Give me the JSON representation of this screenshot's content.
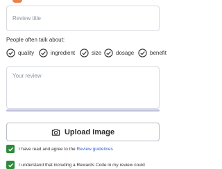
{
  "form": {
    "title_placeholder": "Review title",
    "talk_about_prompt": "People often talk about:",
    "topics": [
      "quality",
      "ingredient",
      "size",
      "dosage",
      "benefit"
    ],
    "review_placeholder": "Your review",
    "length_progress": 1.0,
    "upload_button_label": "Upload Image",
    "guidelines_prefix": "I have read and agree to the ",
    "guidelines_link": "Review guidelines",
    "rewards_text": "I understand that including a Rewards Code in my review could"
  },
  "colors": {
    "accent_green": "#2e8b3c",
    "link_blue": "#3366cc",
    "border": "#d6d9df"
  },
  "icons": {
    "chip": "circle-check-icon",
    "upload": "camera-icon",
    "checkbox": "check-icon"
  }
}
